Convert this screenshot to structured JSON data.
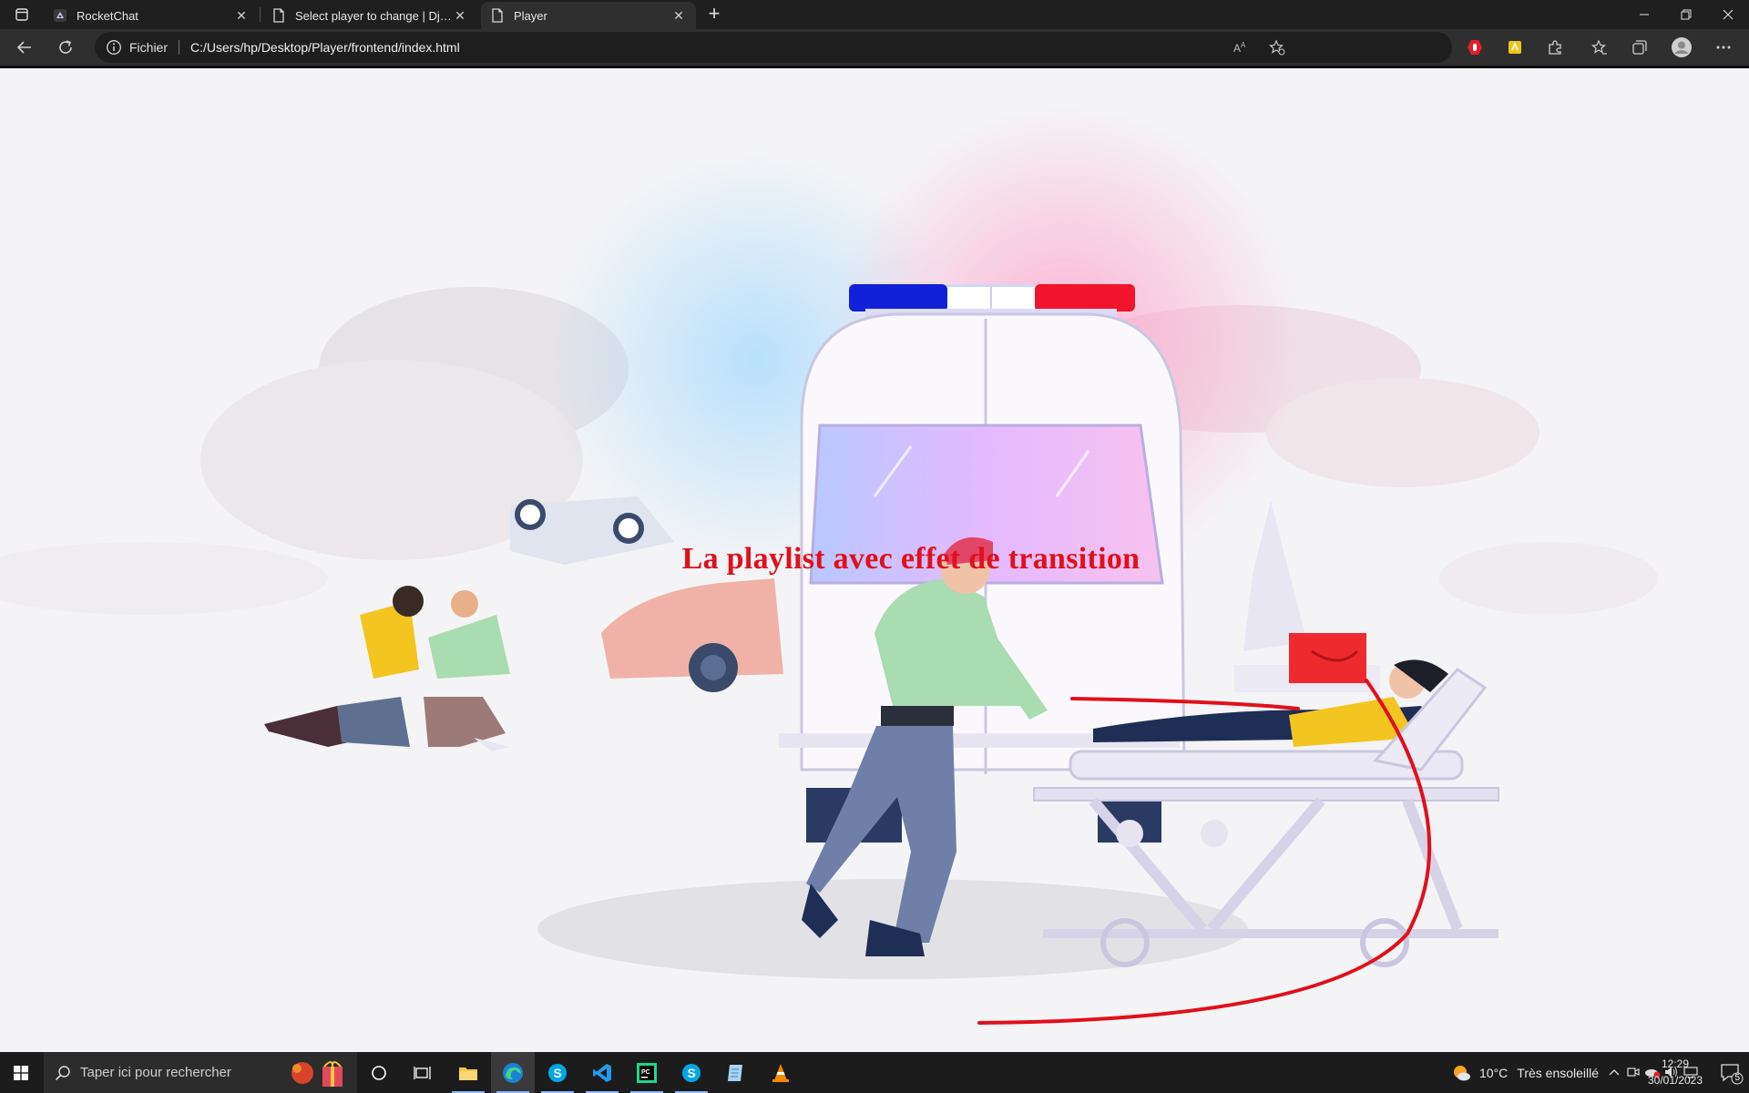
{
  "browser": {
    "tabs": [
      {
        "title": "RocketChat",
        "icon": "rocketchat-icon",
        "active": false
      },
      {
        "title": "Select player to change | Django",
        "icon": "page-icon",
        "active": false
      },
      {
        "title": "Player",
        "icon": "page-icon",
        "active": true
      }
    ],
    "address": {
      "scheme_label": "Fichier",
      "url": "C:/Users/hp/Desktop/Player/frontend/index.html"
    }
  },
  "page": {
    "heading": "La playlist avec effet de transition",
    "heading_color": "#e0101c",
    "background": "video-frame-ambulance-illustration"
  },
  "taskbar": {
    "search_placeholder": "Taper ici pour rechercher",
    "apps": [
      "cortana-icon",
      "task-view-icon",
      "file-explorer-icon",
      "edge-icon",
      "skype-icon",
      "vscode-icon",
      "pycharm-icon",
      "skype-icon",
      "notepad-icon",
      "vlc-icon"
    ],
    "weather": {
      "temperature": "10°C",
      "description": "Très ensoleillé"
    },
    "clock": {
      "time": "12:29",
      "date": "30/01/2023"
    },
    "notifications_count": "5"
  },
  "colors": {
    "titlebar": "#1f1f1f",
    "toolbar": "#2f2f2f",
    "taskbar": "#1c1c1c",
    "accent_red": "#e0101c"
  }
}
